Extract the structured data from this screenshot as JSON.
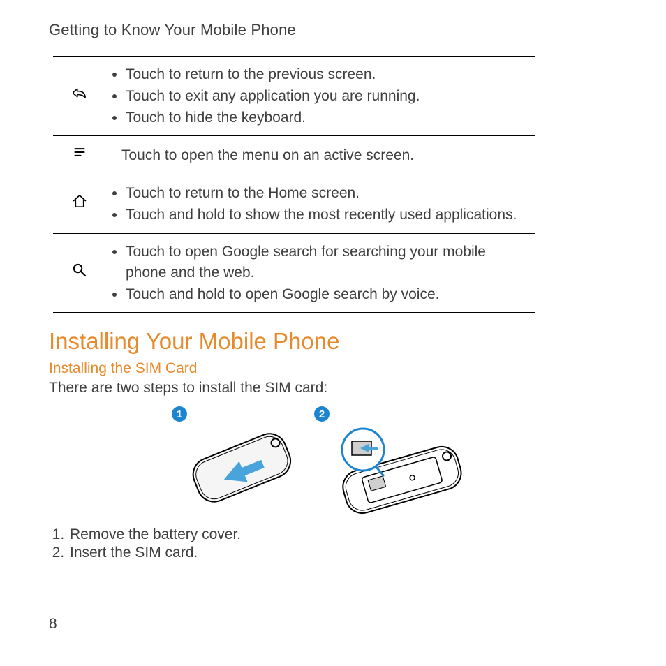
{
  "header": {
    "title": "Getting to Know Your Mobile Phone"
  },
  "iconTable": {
    "rows": [
      {
        "icon": "back-icon",
        "items": [
          "Touch to return to the previous screen.",
          "Touch to exit any application you are running.",
          "Touch to hide the keyboard."
        ]
      },
      {
        "icon": "menu-icon",
        "plain": "Touch to open the menu on an active screen."
      },
      {
        "icon": "home-icon",
        "items": [
          "Touch to return to the Home screen.",
          "Touch and hold to show the most recently used applications."
        ]
      },
      {
        "icon": "search-icon",
        "items": [
          "Touch to open Google search for searching your mobile phone and the web.",
          "Touch and hold to open Google search by voice."
        ]
      }
    ]
  },
  "sections": {
    "installPhone": {
      "title": "Installing Your Mobile Phone",
      "sim": {
        "title": "Installing the SIM Card",
        "intro": "There are two steps to install the SIM card:",
        "badges": {
          "one": "1",
          "two": "2"
        },
        "steps": [
          "Remove the battery cover.",
          "Insert the SIM card."
        ]
      }
    }
  },
  "page": {
    "number": "8"
  },
  "colors": {
    "accent": "#e78a2b",
    "brand": "#1d85d0",
    "arrow": "#4aa4dc"
  }
}
